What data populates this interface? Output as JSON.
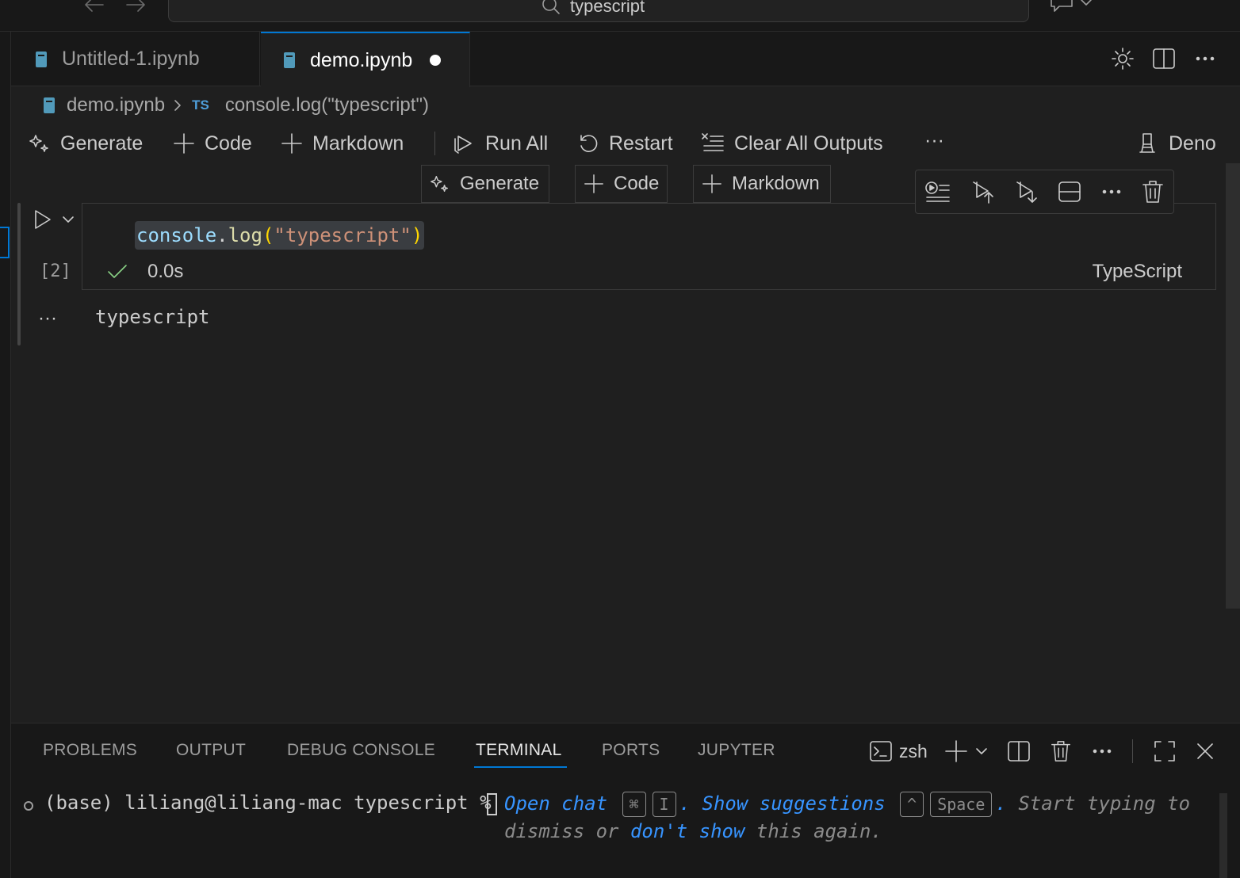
{
  "titlebar": {
    "search_text": "typescript"
  },
  "tabs": [
    {
      "label": "Untitled-1.ipynb",
      "active": false,
      "dirty": false
    },
    {
      "label": "demo.ipynb",
      "active": true,
      "dirty": true
    }
  ],
  "breadcrumb": {
    "file": "demo.ipynb",
    "lang_badge": "TS",
    "symbol": "console.log(\"typescript\")"
  },
  "notebook_toolbar": {
    "generate": "Generate",
    "code": "Code",
    "markdown": "Markdown",
    "run_all": "Run All",
    "restart": "Restart",
    "clear_all_outputs": "Clear All Outputs",
    "more": "···",
    "kernel": "Deno"
  },
  "insert_toolbar": {
    "generate": "Generate",
    "code": "Code",
    "markdown": "Markdown"
  },
  "cell": {
    "code_tokens": {
      "obj": "console",
      "dot": ".",
      "fn": "log",
      "open": "(",
      "str": "\"typescript\"",
      "close": ")"
    },
    "exec_count": "[2]",
    "exec_time": "0.0s",
    "language": "TypeScript",
    "output_more": "···",
    "output": "typescript"
  },
  "panel": {
    "tabs": [
      "PROBLEMS",
      "OUTPUT",
      "DEBUG CONSOLE",
      "TERMINAL",
      "PORTS",
      "JUPYTER"
    ],
    "active_tab": "TERMINAL",
    "shell": "zsh",
    "more": "···"
  },
  "terminal": {
    "prompt": "(base) liliang@liliang-mac typescript %",
    "hint_open_chat": "Open chat",
    "kbd_cmd": "⌘",
    "kbd_i": "I",
    "period1": ".",
    "hint_show_suggestions": "Show suggestions",
    "kbd_ctrl": "^",
    "kbd_space": "Space",
    "period2": ".",
    "hint_start_typing": "Start typing to",
    "hint_dismiss": "dismiss or",
    "hint_dont_show": "don't show",
    "hint_again": "this again."
  },
  "colors": {
    "accent": "#0078d4",
    "notebook_icon": "#519aba",
    "success": "#89d185",
    "link": "#3794ff"
  }
}
